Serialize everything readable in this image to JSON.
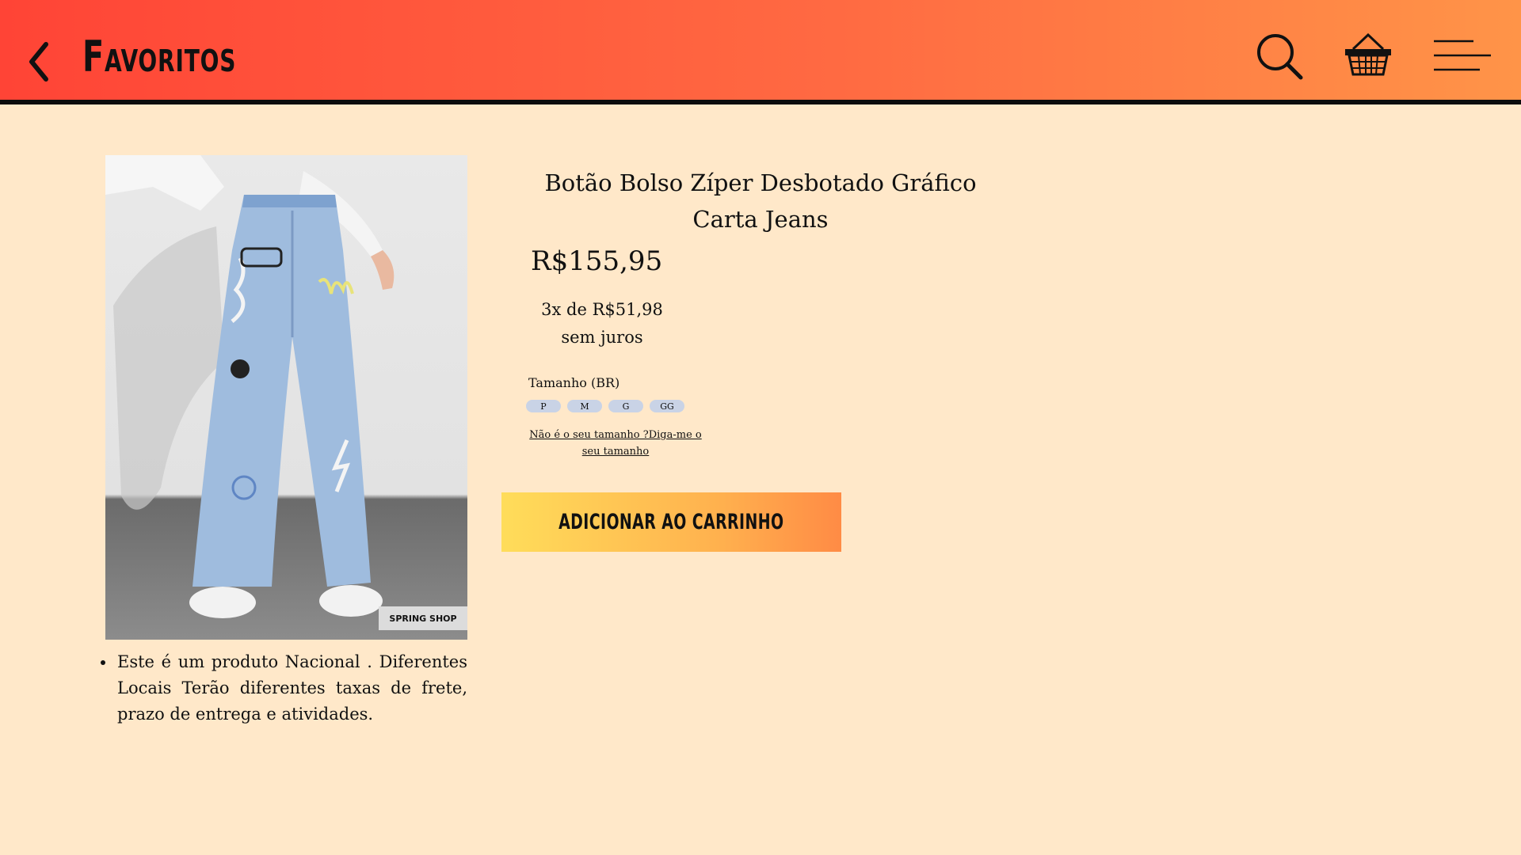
{
  "header": {
    "title": "Favoritos",
    "icons": [
      "chevron-left-icon",
      "search-icon",
      "basket-icon",
      "menu-icon"
    ],
    "gradient": [
      "#ff4436",
      "#ff9448"
    ]
  },
  "product": {
    "image_tag": "SPRING SHOP",
    "name": "Botão Bolso Zíper Desbotado Gráfico Carta Jeans",
    "price": "R$155,95",
    "installments": "3x de R$51,98 sem juros",
    "size_label": "Tamanho (BR)",
    "sizes": [
      "P",
      "M",
      "G",
      "GG"
    ],
    "size_help": "Não é o seu tamanho ?Diga-me o seu tamanho",
    "description": "Este é um produto Nacional . Diferentes Locais Terão diferentes taxas de frete, prazo de entrega e atividades.",
    "add_to_cart": "ADICIONAR AO CARRINHO"
  },
  "colors": {
    "background": "#ffe8c9",
    "button_gradient": [
      "#ffdd5a",
      "#ff8b45"
    ],
    "size_pill": "#c9d3e6"
  }
}
